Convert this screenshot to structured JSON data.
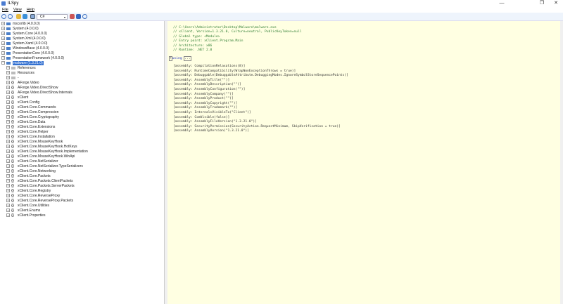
{
  "window": {
    "title": "ILSpy",
    "minimize": "—",
    "maximize": "❐",
    "close": "✕"
  },
  "menu": [
    "File",
    "View",
    "Help"
  ],
  "toolbar": {
    "language": "C#",
    "dropdown": "▾"
  },
  "tree": {
    "assemblies": [
      "mscorlib (4.0.0.0)",
      "System (4.0.0.0)",
      "System.Core (4.0.0.0)",
      "System.Xml (4.0.0.0)",
      "System.Xaml (4.0.0.0)",
      "WindowsBase (4.0.0.0)",
      "PresentationCore (4.0.0.0)",
      "PresentationFramework (4.0.0.0)"
    ],
    "selected": "malware (1.3.21.0)",
    "children": [
      "References",
      "Resources",
      "-"
    ],
    "namespaces": [
      "AForge.Video",
      "AForge.Video.DirectShow",
      "AForge.Video.DirectShow.Internals",
      "xClient",
      "xClient.Config",
      "xClient.Core.Commands",
      "xClient.Core.Compression",
      "xClient.Core.Cryptography",
      "xClient.Core.Data",
      "xClient.Core.Extensions",
      "xClient.Core.Helper",
      "xClient.Core.Installation",
      "xClient.Core.MouseKeyHook",
      "xClient.Core.MouseKeyHook.HotKeys",
      "xClient.Core.MouseKeyHook.Implementation",
      "xClient.Core.MouseKeyHook.WinApi",
      "xClient.Core.NetSerializer",
      "xClient.Core.NetSerializer.TypeSerializers",
      "xClient.Core.Networking",
      "xClient.Core.Packets",
      "xClient.Core.Packets.ClientPackets",
      "xClient.Core.Packets.ServerPackets",
      "xClient.Core.Registry",
      "xClient.Core.ReverseProxy",
      "xClient.Core.ReverseProxy.Packets",
      "xClient.Core.Utilities",
      "xClient.Enums",
      "xClient.Properties"
    ]
  },
  "code": {
    "comments": [
      "// C:\\Users\\Administrator\\Desktop\\Malware\\malware.exe",
      "// xClient, Version=1.3.21.0, Culture=neutral, PublicKeyToken=null",
      "// Global type: <Module>",
      "// Entry point: xClient.Program.Main",
      "// Architecture: x86",
      "// Runtime: .NET 2.0"
    ],
    "using": "using",
    "using_collapsed": "...",
    "attributes": [
      "[assembly: CompilationRelaxations(8)]",
      "[assembly: RuntimeCompatibility(WrapNonExceptionThrows = true)]",
      "[assembly: Debuggable(DebuggableAttribute.DebuggingModes.IgnoreSymbolStoreSequencePoints)]",
      "[assembly: AssemblyTitle(\"\")]",
      "[assembly: AssemblyDescription(\"\")]",
      "[assembly: AssemblyConfiguration(\"\")]",
      "[assembly: AssemblyCompany(\"\")]",
      "[assembly: AssemblyProduct(\"\")]",
      "[assembly: AssemblyCopyright(\"\")]",
      "[assembly: AssemblyTrademark(\"\")]",
      "[assembly: InternalsVisibleTo(\"Client\")]",
      "[assembly: ComVisible(false)]",
      "[assembly: AssemblyFileVersion(\"1.3.21.0\")]",
      "[assembly: SecurityPermission(SecurityAction.RequestMinimum, SkipVerification = true)]",
      "[assembly: AssemblyVersion(\"1.3.21.0\")]"
    ]
  },
  "colors": {
    "code_bg": "#ffffe2",
    "selection": "#3370d0",
    "comment": "#2e7d32"
  }
}
